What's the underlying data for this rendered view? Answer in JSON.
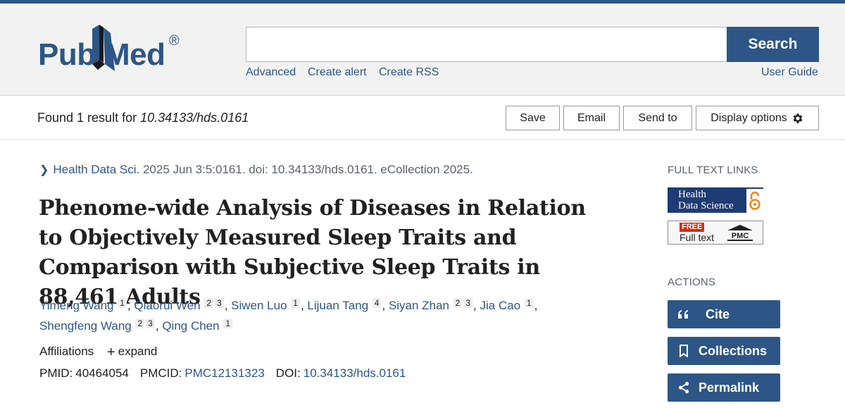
{
  "logo": {
    "text_left": "Pub",
    "text_right": "Med",
    "registered": "®"
  },
  "search": {
    "value": "",
    "placeholder": "",
    "button_label": "Search"
  },
  "header_links": {
    "advanced": "Advanced",
    "create_alert": "Create alert",
    "create_rss": "Create RSS",
    "user_guide": "User Guide"
  },
  "results": {
    "found_prefix": "Found 1 result for ",
    "query": "10.34133/hds.0161",
    "save": "Save",
    "email": "Email",
    "send_to": "Send to",
    "display_options": "Display options"
  },
  "article": {
    "journal": "Health Data Sci.",
    "citation": " 2025 Jun 3:5:0161. doi: 10.34133/hds.0161. eCollection 2025.",
    "title": "Phenome-wide Analysis of Diseases in Relation to Objectively Measured Sleep Traits and Comparison with Subjective Sleep Traits in 88,461 Adults",
    "authors": [
      {
        "name": "Yimeng Wang",
        "affils": [
          "1"
        ]
      },
      {
        "name": "Qiaorui Wen",
        "affils": [
          "2",
          "3"
        ]
      },
      {
        "name": "Siwen Luo",
        "affils": [
          "1"
        ]
      },
      {
        "name": "Lijuan Tang",
        "affils": [
          "4"
        ]
      },
      {
        "name": "Siyan Zhan",
        "affils": [
          "2",
          "3"
        ]
      },
      {
        "name": "Jia Cao",
        "affils": [
          "1"
        ]
      },
      {
        "name": "Shengfeng Wang",
        "affils": [
          "2",
          "3"
        ]
      },
      {
        "name": "Qing Chen",
        "affils": [
          "1"
        ]
      }
    ],
    "affiliations_label": "Affiliations",
    "expand_label": "expand",
    "pmid_label": "PMID:",
    "pmid": "40464054",
    "pmcid_label": "PMCID:",
    "pmcid": "PMC12131323",
    "doi_label": "DOI:",
    "doi": "10.34133/hds.0161"
  },
  "sidebar": {
    "full_text_heading": "FULL TEXT LINKS",
    "hds_line1": "Health",
    "hds_line2": "Data Science",
    "pmc_free": "FREE",
    "pmc_fulltext": "Full text",
    "pmc_mark": "PMC",
    "actions_heading": "ACTIONS",
    "cite": "Cite",
    "collections": "Collections",
    "permalink": "Permalink"
  },
  "colors": {
    "brand_blue": "#2d5686",
    "link_blue": "#2d5686",
    "hds_navy": "#1f3b73",
    "free_red": "#d9290e"
  },
  "icons": [
    "chevron-right-icon",
    "gear-icon",
    "plus-icon",
    "quote-icon",
    "bookmark-icon",
    "share-icon",
    "open-access-icon"
  ]
}
